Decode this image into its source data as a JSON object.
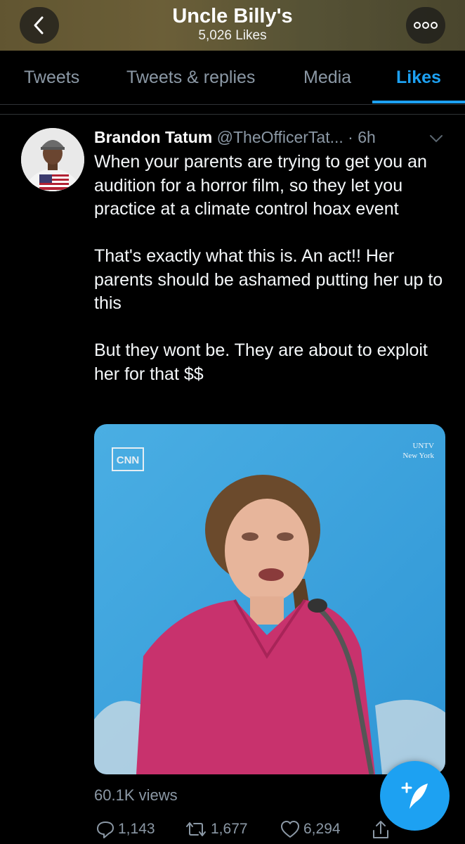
{
  "header": {
    "title": "Uncle Billy's",
    "subtitle": "5,026 Likes",
    "back_icon": "chevron-left-icon",
    "more_icon": "more-options-icon"
  },
  "tabs": [
    {
      "label": "Tweets",
      "active": false
    },
    {
      "label": "Tweets & replies",
      "active": false
    },
    {
      "label": "Media",
      "active": false
    },
    {
      "label": "Likes",
      "active": true
    }
  ],
  "tweet": {
    "author_name": "Brandon Tatum",
    "author_handle": "@TheOfficerTat...",
    "separator": " · ",
    "time": "6h",
    "paragraphs": [
      "When your parents are trying to get you an audition for a horror film, so they let you practice at a climate control hoax event",
      "That's exactly what this is. An act!! Her parents should be ashamed putting her up to this",
      "But they wont be. They are about to exploit her for that $$"
    ],
    "media": {
      "watermark_left": "CNN",
      "watermark_right_line1": "UNTV",
      "watermark_right_line2": "New York"
    },
    "views": "60.1K views",
    "replies": "1,143",
    "retweets": "1,677",
    "likes": "6,294"
  },
  "colors": {
    "accent": "#1da1f2",
    "muted": "#8b98a5",
    "background": "#000000"
  }
}
